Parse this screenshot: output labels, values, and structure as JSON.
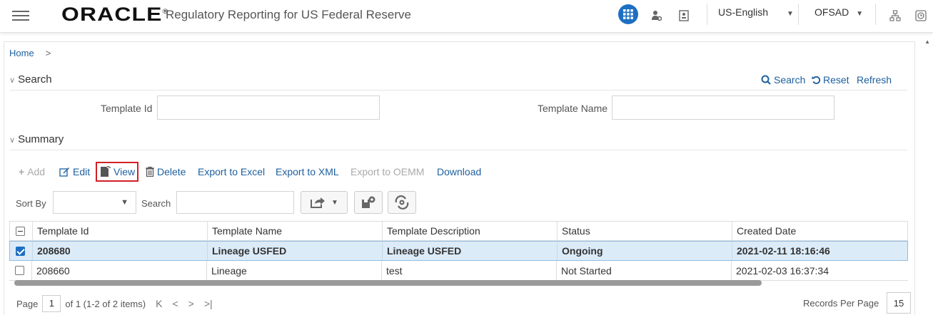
{
  "header": {
    "brand": "ORACLE",
    "brand_mark": "®",
    "app_title": "Regulatory Reporting for US Federal Reserve",
    "language": "US-English",
    "user": "OFSAD"
  },
  "breadcrumb": {
    "home": "Home"
  },
  "search": {
    "section_title": "Search",
    "search_link": "Search",
    "reset_link": "Reset",
    "refresh_link": "Refresh",
    "template_id_label": "Template Id",
    "template_id_value": "",
    "template_name_label": "Template Name",
    "template_name_value": ""
  },
  "summary": {
    "section_title": "Summary",
    "toolbar": {
      "add": "Add",
      "edit": "Edit",
      "view": "View",
      "delete": "Delete",
      "export_excel": "Export to Excel",
      "export_xml": "Export to XML",
      "export_oemm": "Export to OEMM",
      "download": "Download"
    },
    "sort_by_label": "Sort By",
    "sort_by_value": "",
    "search_label": "Search",
    "search_value": "",
    "columns": [
      "Template Id",
      "Template Name",
      "Template Description",
      "Status",
      "Created Date"
    ],
    "rows": [
      [
        "208680",
        "Lineage USFED",
        "Lineage USFED",
        "Ongoing",
        "2021-02-11 18:16:46"
      ],
      [
        "208660",
        "Lineage",
        "test",
        "Not Started",
        "2021-02-03 16:37:34"
      ]
    ]
  },
  "pager": {
    "page_label": "Page",
    "page_value": "1",
    "of_text": "of 1 (1-2 of 2 items)",
    "records_per_page_label": "Records Per Page",
    "records_per_page_value": "15"
  },
  "colors": {
    "accent": "#1d6fc2",
    "link": "#1d5f9e",
    "highlight": "#d21f26",
    "selected_row": "#dcebf8"
  }
}
